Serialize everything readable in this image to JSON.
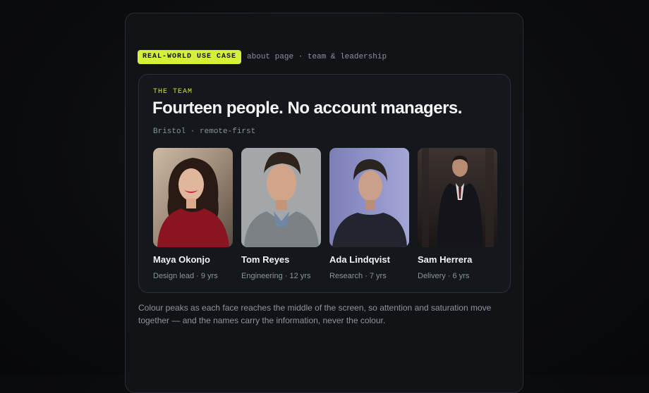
{
  "tag": {
    "badge": "REAL-WORLD USE CASE",
    "breadcrumb": "about page · team & leadership"
  },
  "team": {
    "eyebrow": "THE TEAM",
    "title": "Fourteen people. No account managers.",
    "meta": "Bristol · remote-first",
    "people": [
      {
        "name": "Maya Okonjo",
        "role": "Design lead · 9 yrs"
      },
      {
        "name": "Tom Reyes",
        "role": "Engineering · 12 yrs"
      },
      {
        "name": "Ada Lindqvist",
        "role": "Research · 7 yrs"
      },
      {
        "name": "Sam Herrera",
        "role": "Delivery · 6 yrs"
      }
    ]
  },
  "caption": "Colour peaks as each face reaches the middle of the screen, so attention and saturation move together — and the names carry the information, never the colour.",
  "colors": {
    "accent": "#d4f03a",
    "page_bg": "#0b0c0e",
    "card_bg": "#14171b"
  }
}
